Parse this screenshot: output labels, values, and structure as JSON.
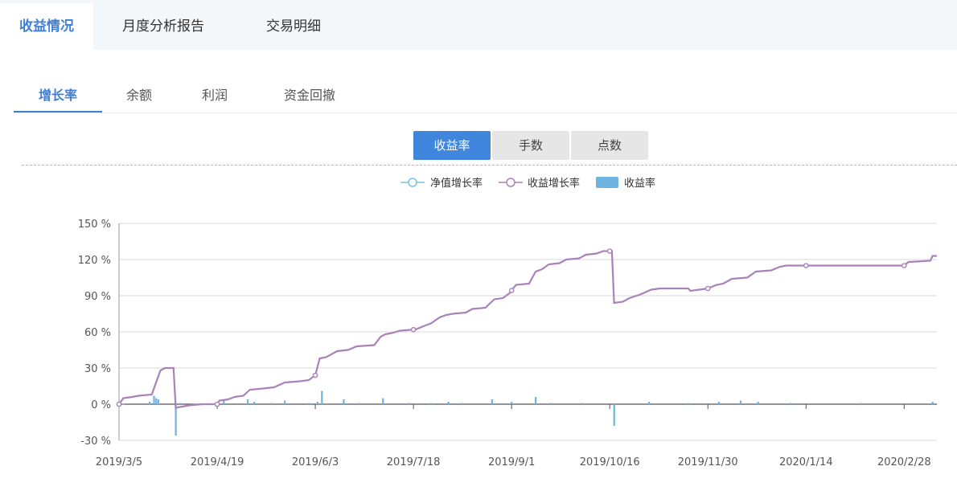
{
  "top_tabs": [
    {
      "label": "收益情况",
      "active": true
    },
    {
      "label": "月度分析报告",
      "active": false
    },
    {
      "label": "交易明细",
      "active": false
    }
  ],
  "sub_tabs": [
    {
      "label": "增长率",
      "active": true
    },
    {
      "label": "余额",
      "active": false
    },
    {
      "label": "利润",
      "active": false
    },
    {
      "label": "资金回撤",
      "active": false
    }
  ],
  "segments": [
    {
      "label": "收益率",
      "active": true
    },
    {
      "label": "手数",
      "active": false
    },
    {
      "label": "点数",
      "active": false
    }
  ],
  "colors": {
    "accent": "#3f7fd6",
    "net_line": "#7ec0e6",
    "profit_line": "#a882b8",
    "bars": "#6fb4e0"
  },
  "chart_data": {
    "type": "line",
    "legend": [
      "净值增长率",
      "收益增长率",
      "收益率"
    ],
    "legend_position": "top-center",
    "grid": true,
    "ylim": [
      -30,
      150
    ],
    "y_ticks": [
      "-30 %",
      "0 %",
      "30 %",
      "60 %",
      "90 %",
      "120 %",
      "150 %"
    ],
    "y_tick_values": [
      -30,
      0,
      30,
      60,
      90,
      120,
      150
    ],
    "x_ticks": [
      "2019/3/5",
      "2019/4/19",
      "2019/6/3",
      "2019/7/18",
      "2019/9/1",
      "2019/10/16",
      "2019/11/30",
      "2020/1/14",
      "2020/2/28"
    ],
    "xlim": [
      "2019/3/5",
      "2020/3/14"
    ],
    "series": [
      {
        "name": "收益增长率",
        "type": "line",
        "points": [
          [
            "2019/3/5",
            0
          ],
          [
            "2019/3/7",
            5
          ],
          [
            "2019/3/11",
            6
          ],
          [
            "2019/3/14",
            7
          ],
          [
            "2019/3/20",
            8
          ],
          [
            "2019/3/24",
            28
          ],
          [
            "2019/3/26",
            30
          ],
          [
            "2019/3/30",
            30
          ],
          [
            "2019/3/31",
            -3
          ],
          [
            "2019/4/3",
            -2
          ],
          [
            "2019/4/6",
            -1
          ],
          [
            "2019/4/12",
            0
          ],
          [
            "2019/4/19",
            0
          ],
          [
            "2019/4/20",
            3
          ],
          [
            "2019/4/24",
            4
          ],
          [
            "2019/4/27",
            6
          ],
          [
            "2019/5/1",
            7
          ],
          [
            "2019/5/4",
            12
          ],
          [
            "2019/5/10",
            13
          ],
          [
            "2019/5/15",
            14
          ],
          [
            "2019/5/20",
            18
          ],
          [
            "2019/5/27",
            19
          ],
          [
            "2019/5/31",
            20
          ],
          [
            "2019/6/3",
            24
          ],
          [
            "2019/6/5",
            38
          ],
          [
            "2019/6/8",
            39
          ],
          [
            "2019/6/13",
            44
          ],
          [
            "2019/6/18",
            45
          ],
          [
            "2019/6/22",
            48
          ],
          [
            "2019/6/30",
            49
          ],
          [
            "2019/7/3",
            56
          ],
          [
            "2019/7/5",
            58
          ],
          [
            "2019/7/8",
            59
          ],
          [
            "2019/7/12",
            61
          ],
          [
            "2019/7/19",
            62
          ],
          [
            "2019/7/23",
            65
          ],
          [
            "2019/7/26",
            67
          ],
          [
            "2019/7/30",
            72
          ],
          [
            "2019/8/2",
            74
          ],
          [
            "2019/8/5",
            75
          ],
          [
            "2019/8/11",
            76
          ],
          [
            "2019/8/14",
            79
          ],
          [
            "2019/8/20",
            80
          ],
          [
            "2019/8/24",
            87
          ],
          [
            "2019/8/28",
            88
          ],
          [
            "2019/8/31",
            92
          ],
          [
            "2019/9/3",
            99
          ],
          [
            "2019/9/9",
            100
          ],
          [
            "2019/9/12",
            110
          ],
          [
            "2019/9/15",
            112
          ],
          [
            "2019/9/18",
            116
          ],
          [
            "2019/9/23",
            117
          ],
          [
            "2019/9/26",
            120
          ],
          [
            "2019/10/2",
            121
          ],
          [
            "2019/10/5",
            124
          ],
          [
            "2019/10/10",
            125
          ],
          [
            "2019/10/13",
            127
          ],
          [
            "2019/10/17",
            127
          ],
          [
            "2019/10/18",
            84
          ],
          [
            "2019/10/22",
            85
          ],
          [
            "2019/10/25",
            88
          ],
          [
            "2019/10/30",
            91
          ],
          [
            "2019/11/4",
            95
          ],
          [
            "2019/11/8",
            96
          ],
          [
            "2019/11/21",
            96
          ],
          [
            "2019/11/22",
            94
          ],
          [
            "2019/11/26",
            95
          ],
          [
            "2019/11/30",
            96
          ],
          [
            "2019/12/4",
            99
          ],
          [
            "2019/12/7",
            100
          ],
          [
            "2019/12/11",
            104
          ],
          [
            "2019/12/18",
            105
          ],
          [
            "2019/12/22",
            110
          ],
          [
            "2019/12/29",
            111
          ],
          [
            "2020/1/2",
            114
          ],
          [
            "2020/1/5",
            115
          ],
          [
            "2020/1/14",
            115
          ],
          [
            "2020/2/28",
            115
          ],
          [
            "2020/3/1",
            118
          ],
          [
            "2020/3/11",
            119
          ],
          [
            "2020/3/12",
            123
          ],
          [
            "2020/3/14",
            123
          ]
        ],
        "markers": [
          "2019/3/5",
          "2019/4/19",
          "2019/6/3",
          "2019/7/18",
          "2019/9/1",
          "2019/10/16",
          "2019/11/30",
          "2020/1/14",
          "2020/2/28"
        ]
      },
      {
        "name": "收益率",
        "type": "bar",
        "points": [
          [
            "2019/3/7",
            0.5
          ],
          [
            "2019/3/19",
            2
          ],
          [
            "2019/3/21",
            7
          ],
          [
            "2019/3/22",
            5
          ],
          [
            "2019/3/23",
            4
          ],
          [
            "2019/3/31",
            -26
          ],
          [
            "2019/4/2",
            1
          ],
          [
            "2019/4/22",
            3
          ],
          [
            "2019/5/3",
            4
          ],
          [
            "2019/5/6",
            2
          ],
          [
            "2019/5/14",
            1
          ],
          [
            "2019/5/20",
            3
          ],
          [
            "2019/5/31",
            1
          ],
          [
            "2019/6/4",
            2
          ],
          [
            "2019/6/6",
            11
          ],
          [
            "2019/6/16",
            4
          ],
          [
            "2019/6/23",
            1
          ],
          [
            "2019/7/4",
            5
          ],
          [
            "2019/7/16",
            1
          ],
          [
            "2019/7/26",
            1
          ],
          [
            "2019/8/3",
            2
          ],
          [
            "2019/8/9",
            1
          ],
          [
            "2019/8/23",
            4
          ],
          [
            "2019/9/1",
            2
          ],
          [
            "2019/9/12",
            6
          ],
          [
            "2019/9/19",
            1
          ],
          [
            "2019/10/3",
            1
          ],
          [
            "2019/10/18",
            -18
          ],
          [
            "2019/11/3",
            2
          ],
          [
            "2019/11/21",
            1
          ],
          [
            "2019/12/5",
            2
          ],
          [
            "2019/12/15",
            3
          ],
          [
            "2019/12/23",
            2
          ],
          [
            "2020/1/7",
            1
          ],
          [
            "2020/2/8",
            1
          ],
          [
            "2020/3/12",
            2
          ]
        ]
      }
    ]
  }
}
